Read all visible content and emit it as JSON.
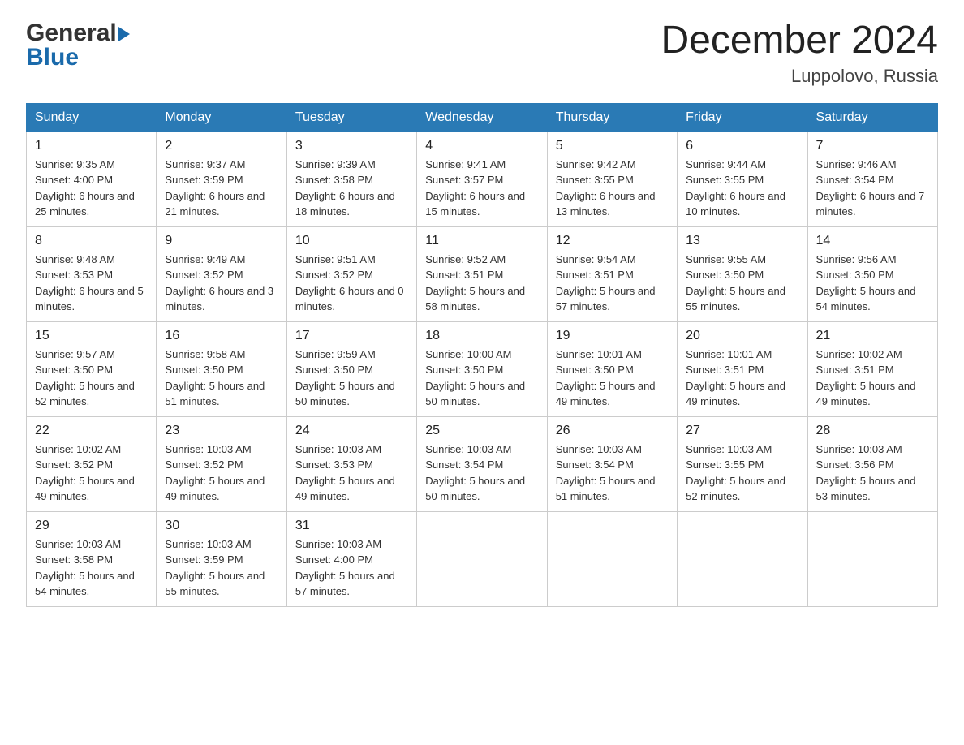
{
  "header": {
    "month_year": "December 2024",
    "location": "Luppolovo, Russia",
    "logo_general": "General",
    "logo_blue": "Blue"
  },
  "days_of_week": [
    "Sunday",
    "Monday",
    "Tuesday",
    "Wednesday",
    "Thursday",
    "Friday",
    "Saturday"
  ],
  "weeks": [
    [
      {
        "num": "1",
        "sunrise": "9:35 AM",
        "sunset": "4:00 PM",
        "daylight": "6 hours and 25 minutes."
      },
      {
        "num": "2",
        "sunrise": "9:37 AM",
        "sunset": "3:59 PM",
        "daylight": "6 hours and 21 minutes."
      },
      {
        "num": "3",
        "sunrise": "9:39 AM",
        "sunset": "3:58 PM",
        "daylight": "6 hours and 18 minutes."
      },
      {
        "num": "4",
        "sunrise": "9:41 AM",
        "sunset": "3:57 PM",
        "daylight": "6 hours and 15 minutes."
      },
      {
        "num": "5",
        "sunrise": "9:42 AM",
        "sunset": "3:55 PM",
        "daylight": "6 hours and 13 minutes."
      },
      {
        "num": "6",
        "sunrise": "9:44 AM",
        "sunset": "3:55 PM",
        "daylight": "6 hours and 10 minutes."
      },
      {
        "num": "7",
        "sunrise": "9:46 AM",
        "sunset": "3:54 PM",
        "daylight": "6 hours and 7 minutes."
      }
    ],
    [
      {
        "num": "8",
        "sunrise": "9:48 AM",
        "sunset": "3:53 PM",
        "daylight": "6 hours and 5 minutes."
      },
      {
        "num": "9",
        "sunrise": "9:49 AM",
        "sunset": "3:52 PM",
        "daylight": "6 hours and 3 minutes."
      },
      {
        "num": "10",
        "sunrise": "9:51 AM",
        "sunset": "3:52 PM",
        "daylight": "6 hours and 0 minutes."
      },
      {
        "num": "11",
        "sunrise": "9:52 AM",
        "sunset": "3:51 PM",
        "daylight": "5 hours and 58 minutes."
      },
      {
        "num": "12",
        "sunrise": "9:54 AM",
        "sunset": "3:51 PM",
        "daylight": "5 hours and 57 minutes."
      },
      {
        "num": "13",
        "sunrise": "9:55 AM",
        "sunset": "3:50 PM",
        "daylight": "5 hours and 55 minutes."
      },
      {
        "num": "14",
        "sunrise": "9:56 AM",
        "sunset": "3:50 PM",
        "daylight": "5 hours and 54 minutes."
      }
    ],
    [
      {
        "num": "15",
        "sunrise": "9:57 AM",
        "sunset": "3:50 PM",
        "daylight": "5 hours and 52 minutes."
      },
      {
        "num": "16",
        "sunrise": "9:58 AM",
        "sunset": "3:50 PM",
        "daylight": "5 hours and 51 minutes."
      },
      {
        "num": "17",
        "sunrise": "9:59 AM",
        "sunset": "3:50 PM",
        "daylight": "5 hours and 50 minutes."
      },
      {
        "num": "18",
        "sunrise": "10:00 AM",
        "sunset": "3:50 PM",
        "daylight": "5 hours and 50 minutes."
      },
      {
        "num": "19",
        "sunrise": "10:01 AM",
        "sunset": "3:50 PM",
        "daylight": "5 hours and 49 minutes."
      },
      {
        "num": "20",
        "sunrise": "10:01 AM",
        "sunset": "3:51 PM",
        "daylight": "5 hours and 49 minutes."
      },
      {
        "num": "21",
        "sunrise": "10:02 AM",
        "sunset": "3:51 PM",
        "daylight": "5 hours and 49 minutes."
      }
    ],
    [
      {
        "num": "22",
        "sunrise": "10:02 AM",
        "sunset": "3:52 PM",
        "daylight": "5 hours and 49 minutes."
      },
      {
        "num": "23",
        "sunrise": "10:03 AM",
        "sunset": "3:52 PM",
        "daylight": "5 hours and 49 minutes."
      },
      {
        "num": "24",
        "sunrise": "10:03 AM",
        "sunset": "3:53 PM",
        "daylight": "5 hours and 49 minutes."
      },
      {
        "num": "25",
        "sunrise": "10:03 AM",
        "sunset": "3:54 PM",
        "daylight": "5 hours and 50 minutes."
      },
      {
        "num": "26",
        "sunrise": "10:03 AM",
        "sunset": "3:54 PM",
        "daylight": "5 hours and 51 minutes."
      },
      {
        "num": "27",
        "sunrise": "10:03 AM",
        "sunset": "3:55 PM",
        "daylight": "5 hours and 52 minutes."
      },
      {
        "num": "28",
        "sunrise": "10:03 AM",
        "sunset": "3:56 PM",
        "daylight": "5 hours and 53 minutes."
      }
    ],
    [
      {
        "num": "29",
        "sunrise": "10:03 AM",
        "sunset": "3:58 PM",
        "daylight": "5 hours and 54 minutes."
      },
      {
        "num": "30",
        "sunrise": "10:03 AM",
        "sunset": "3:59 PM",
        "daylight": "5 hours and 55 minutes."
      },
      {
        "num": "31",
        "sunrise": "10:03 AM",
        "sunset": "4:00 PM",
        "daylight": "5 hours and 57 minutes."
      },
      null,
      null,
      null,
      null
    ]
  ]
}
